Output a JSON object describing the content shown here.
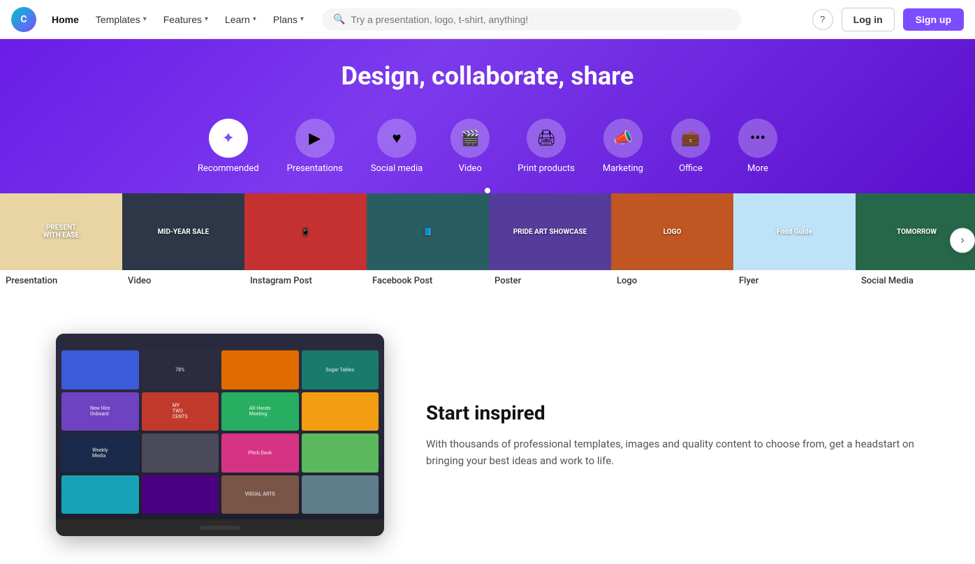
{
  "brand": {
    "logo_text": "C",
    "logo_alt": "Canva"
  },
  "navbar": {
    "home_label": "Home",
    "templates_label": "Templates",
    "features_label": "Features",
    "learn_label": "Learn",
    "plans_label": "Plans",
    "search_placeholder": "Try a presentation, logo, t-shirt, anything!",
    "help_icon": "?",
    "login_label": "Log in",
    "signup_label": "Sign up"
  },
  "hero": {
    "title": "Design, collaborate, share",
    "categories": [
      {
        "id": "recommended",
        "label": "Recommended",
        "icon": "✦",
        "active": true
      },
      {
        "id": "presentations",
        "label": "Presentations",
        "icon": "▶",
        "active": false
      },
      {
        "id": "social-media",
        "label": "Social media",
        "icon": "♥",
        "active": false
      },
      {
        "id": "video",
        "label": "Video",
        "icon": "🎬",
        "active": false
      },
      {
        "id": "print-products",
        "label": "Print products",
        "icon": "🖨",
        "active": false
      },
      {
        "id": "marketing",
        "label": "Marketing",
        "icon": "📣",
        "active": false
      },
      {
        "id": "office",
        "label": "Office",
        "icon": "💼",
        "active": false
      },
      {
        "id": "more",
        "label": "More",
        "icon": "•••",
        "active": false
      }
    ]
  },
  "card_strip": {
    "items": [
      {
        "label": "Presentation",
        "color_class": "c1",
        "text": "PRESENT\nWITH EASE"
      },
      {
        "label": "Video",
        "color_class": "c2",
        "text": "MID-YEAR SALE"
      },
      {
        "label": "Instagram Post",
        "color_class": "c3",
        "text": "📱"
      },
      {
        "label": "Facebook Post",
        "color_class": "c4",
        "text": "📘"
      },
      {
        "label": "Poster",
        "color_class": "c5",
        "text": "PRIDE ART SHOWCASE"
      },
      {
        "label": "Logo",
        "color_class": "c6",
        "text": "LOGO"
      },
      {
        "label": "Flyer",
        "color_class": "c7",
        "text": "Food Guide"
      },
      {
        "label": "Social Media",
        "color_class": "c8",
        "text": "TOMORROW"
      }
    ],
    "next_icon": "›"
  },
  "bottom_section": {
    "title": "Start inspired",
    "description": "With thousands of professional templates, images and quality content to choose from, get a headstart on bringing your best ideas and work to life.",
    "laptop_grid": [
      {
        "color": "gc-blue",
        "text": ""
      },
      {
        "color": "gc-dark",
        "text": "78%"
      },
      {
        "color": "gc-orange",
        "text": ""
      },
      {
        "color": "gc-teal",
        "text": "Sugar Tables"
      },
      {
        "color": "gc-purple",
        "text": "New Hire\nOnboard"
      },
      {
        "color": "gc-red",
        "text": "MY\nTWO\nCENTS"
      },
      {
        "color": "gc-green",
        "text": "All-Hands\nMeeting"
      },
      {
        "color": "gc-yellow",
        "text": ""
      },
      {
        "color": "gc-navy",
        "text": "Weekly\nMedia"
      },
      {
        "color": "gc-gray",
        "text": ""
      },
      {
        "color": "gc-pink",
        "text": "Pitch Deck"
      },
      {
        "color": "gc-lime",
        "text": ""
      },
      {
        "color": "gc-cyan",
        "text": ""
      },
      {
        "color": "gc-indigo",
        "text": ""
      },
      {
        "color": "gc-brown",
        "text": "VISUAL ARTS"
      },
      {
        "color": "gc-slate",
        "text": ""
      }
    ]
  }
}
